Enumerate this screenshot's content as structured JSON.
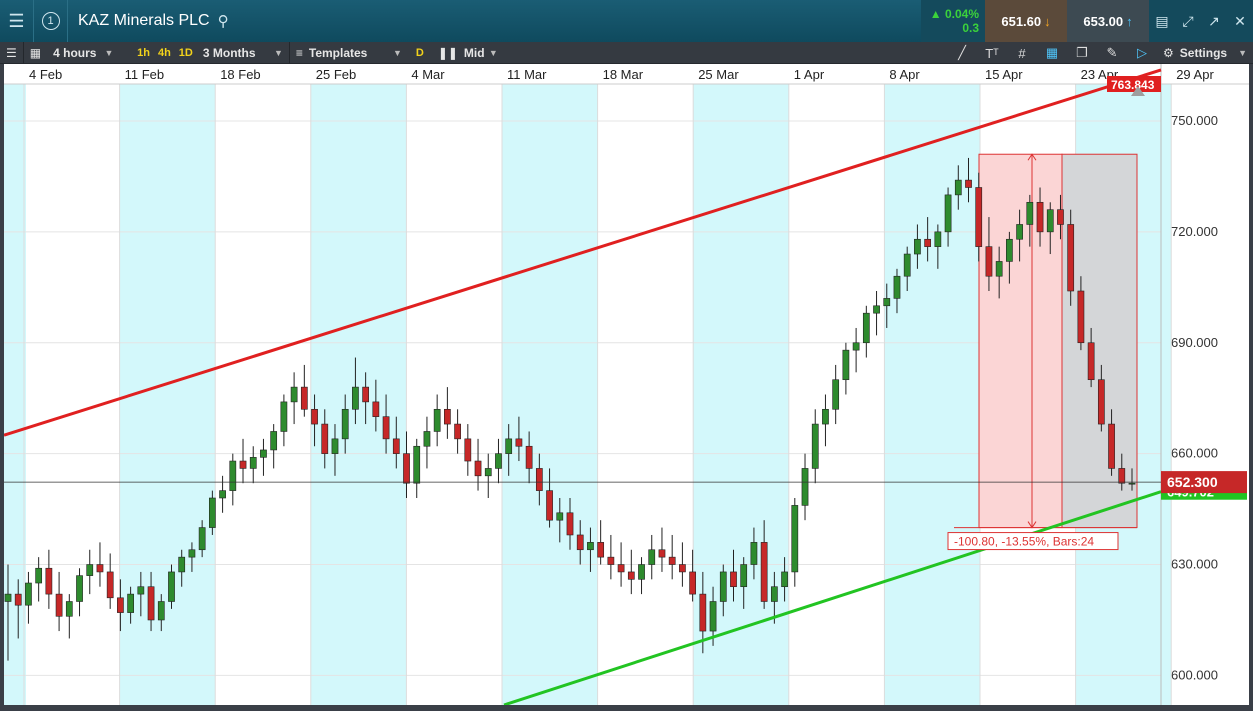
{
  "header": {
    "title": "KAZ Minerals PLC",
    "tab_number": "1",
    "change_pct": "0.04%",
    "change_abs": "0.3",
    "sell_price": "651.60",
    "buy_price": "653.00"
  },
  "toolbar": {
    "interval": "4 hours",
    "quick_1": "1h",
    "quick_2": "4h",
    "quick_3": "1D",
    "range": "3 Months",
    "templates": "Templates",
    "d_button": "D",
    "price_type": "Mid",
    "settings": "Settings"
  },
  "colors": {
    "up_candle": "#2e8b2e",
    "down_candle": "#c62828",
    "upper_trend": "#e02020",
    "lower_trend": "#22c422",
    "weekend_band": "#d3f8fb",
    "measure_fill": "#fbd5d5",
    "measure_gray": "#d4d6d8"
  },
  "chart_data": {
    "type": "candlestick",
    "x_ticks": [
      "4 Feb",
      "11 Feb",
      "18 Feb",
      "25 Feb",
      "4 Mar",
      "11 Mar",
      "18 Mar",
      "25 Mar",
      "1 Apr",
      "8 Apr",
      "15 Apr",
      "23 Apr",
      "29 Apr"
    ],
    "y_ticks": [
      "750.000",
      "720.000",
      "690.000",
      "660.000",
      "630.000",
      "600.000"
    ],
    "ylim": [
      592,
      760
    ],
    "current_price_label": "652.300",
    "current_price": 652.3,
    "upper_trend_label": "763.843",
    "lower_trend_label": "649.702",
    "upper_trendline": [
      {
        "x": 0,
        "y": 665
      },
      {
        "x": 1157,
        "y": 763.8
      }
    ],
    "lower_trendline": [
      {
        "x": 500,
        "y": 592
      },
      {
        "x": 1157,
        "y": 649.7
      }
    ],
    "measure": {
      "label": "-100.80, -13.55%, Bars:24",
      "high": 741,
      "low": 640,
      "start_bar": 985,
      "end_bar": 1133
    },
    "candles": [
      [
        620,
        630,
        604,
        622
      ],
      [
        622,
        626,
        610,
        619
      ],
      [
        619,
        628,
        614,
        625
      ],
      [
        625,
        632,
        620,
        629
      ],
      [
        629,
        634,
        618,
        622
      ],
      [
        622,
        628,
        612,
        616
      ],
      [
        616,
        622,
        610,
        620
      ],
      [
        620,
        629,
        616,
        627
      ],
      [
        627,
        634,
        622,
        630
      ],
      [
        630,
        636,
        624,
        628
      ],
      [
        628,
        633,
        618,
        621
      ],
      [
        621,
        626,
        612,
        617
      ],
      [
        617,
        624,
        614,
        622
      ],
      [
        622,
        628,
        616,
        624
      ],
      [
        624,
        628,
        612,
        615
      ],
      [
        615,
        622,
        612,
        620
      ],
      [
        620,
        630,
        618,
        628
      ],
      [
        628,
        634,
        624,
        632
      ],
      [
        632,
        636,
        628,
        634
      ],
      [
        634,
        642,
        632,
        640
      ],
      [
        640,
        650,
        638,
        648
      ],
      [
        648,
        654,
        644,
        650
      ],
      [
        650,
        660,
        646,
        658
      ],
      [
        658,
        664,
        652,
        656
      ],
      [
        656,
        662,
        652,
        659
      ],
      [
        659,
        664,
        654,
        661
      ],
      [
        661,
        668,
        656,
        666
      ],
      [
        666,
        676,
        662,
        674
      ],
      [
        674,
        682,
        668,
        678
      ],
      [
        678,
        684,
        670,
        672
      ],
      [
        672,
        676,
        662,
        668
      ],
      [
        668,
        672,
        656,
        660
      ],
      [
        660,
        668,
        654,
        664
      ],
      [
        664,
        676,
        660,
        672
      ],
      [
        672,
        686,
        668,
        678
      ],
      [
        678,
        682,
        668,
        674
      ],
      [
        674,
        680,
        666,
        670
      ],
      [
        670,
        676,
        660,
        664
      ],
      [
        664,
        670,
        656,
        660
      ],
      [
        660,
        666,
        648,
        652
      ],
      [
        652,
        664,
        648,
        662
      ],
      [
        662,
        670,
        656,
        666
      ],
      [
        666,
        676,
        662,
        672
      ],
      [
        672,
        678,
        664,
        668
      ],
      [
        668,
        672,
        660,
        664
      ],
      [
        664,
        668,
        654,
        658
      ],
      [
        658,
        664,
        650,
        654
      ],
      [
        654,
        660,
        648,
        656
      ],
      [
        656,
        664,
        652,
        660
      ],
      [
        660,
        668,
        654,
        664
      ],
      [
        664,
        670,
        658,
        662
      ],
      [
        662,
        666,
        652,
        656
      ],
      [
        656,
        660,
        646,
        650
      ],
      [
        650,
        656,
        640,
        642
      ],
      [
        642,
        648,
        636,
        644
      ],
      [
        644,
        648,
        634,
        638
      ],
      [
        638,
        642,
        630,
        634
      ],
      [
        634,
        640,
        628,
        636
      ],
      [
        636,
        642,
        630,
        632
      ],
      [
        632,
        638,
        626,
        630
      ],
      [
        630,
        636,
        624,
        628
      ],
      [
        628,
        634,
        622,
        626
      ],
      [
        626,
        632,
        622,
        630
      ],
      [
        630,
        638,
        626,
        634
      ],
      [
        634,
        640,
        628,
        632
      ],
      [
        632,
        638,
        626,
        630
      ],
      [
        630,
        636,
        624,
        628
      ],
      [
        628,
        634,
        620,
        622
      ],
      [
        622,
        628,
        606,
        612
      ],
      [
        612,
        624,
        608,
        620
      ],
      [
        620,
        630,
        616,
        628
      ],
      [
        628,
        634,
        620,
        624
      ],
      [
        624,
        632,
        618,
        630
      ],
      [
        630,
        640,
        626,
        636
      ],
      [
        636,
        642,
        618,
        620
      ],
      [
        620,
        628,
        614,
        624
      ],
      [
        624,
        632,
        620,
        628
      ],
      [
        628,
        648,
        624,
        646
      ],
      [
        646,
        660,
        642,
        656
      ],
      [
        656,
        672,
        652,
        668
      ],
      [
        668,
        676,
        662,
        672
      ],
      [
        672,
        684,
        668,
        680
      ],
      [
        680,
        690,
        676,
        688
      ],
      [
        688,
        694,
        682,
        690
      ],
      [
        690,
        700,
        686,
        698
      ],
      [
        698,
        704,
        692,
        700
      ],
      [
        700,
        706,
        694,
        702
      ],
      [
        702,
        710,
        698,
        708
      ],
      [
        708,
        716,
        704,
        714
      ],
      [
        714,
        722,
        710,
        718
      ],
      [
        718,
        724,
        712,
        716
      ],
      [
        716,
        722,
        710,
        720
      ],
      [
        720,
        732,
        716,
        730
      ],
      [
        730,
        738,
        726,
        734
      ],
      [
        734,
        740,
        728,
        732
      ],
      [
        732,
        736,
        712,
        716
      ],
      [
        716,
        724,
        704,
        708
      ],
      [
        708,
        716,
        702,
        712
      ],
      [
        712,
        720,
        706,
        718
      ],
      [
        718,
        726,
        712,
        722
      ],
      [
        722,
        730,
        716,
        728
      ],
      [
        728,
        732,
        716,
        720
      ],
      [
        720,
        728,
        714,
        726
      ],
      [
        726,
        730,
        718,
        722
      ],
      [
        722,
        726,
        700,
        704
      ],
      [
        704,
        708,
        688,
        690
      ],
      [
        690,
        694,
        678,
        680
      ],
      [
        680,
        684,
        666,
        668
      ],
      [
        668,
        672,
        654,
        656
      ],
      [
        656,
        660,
        650,
        652
      ],
      [
        652,
        656,
        650,
        652
      ]
    ]
  }
}
